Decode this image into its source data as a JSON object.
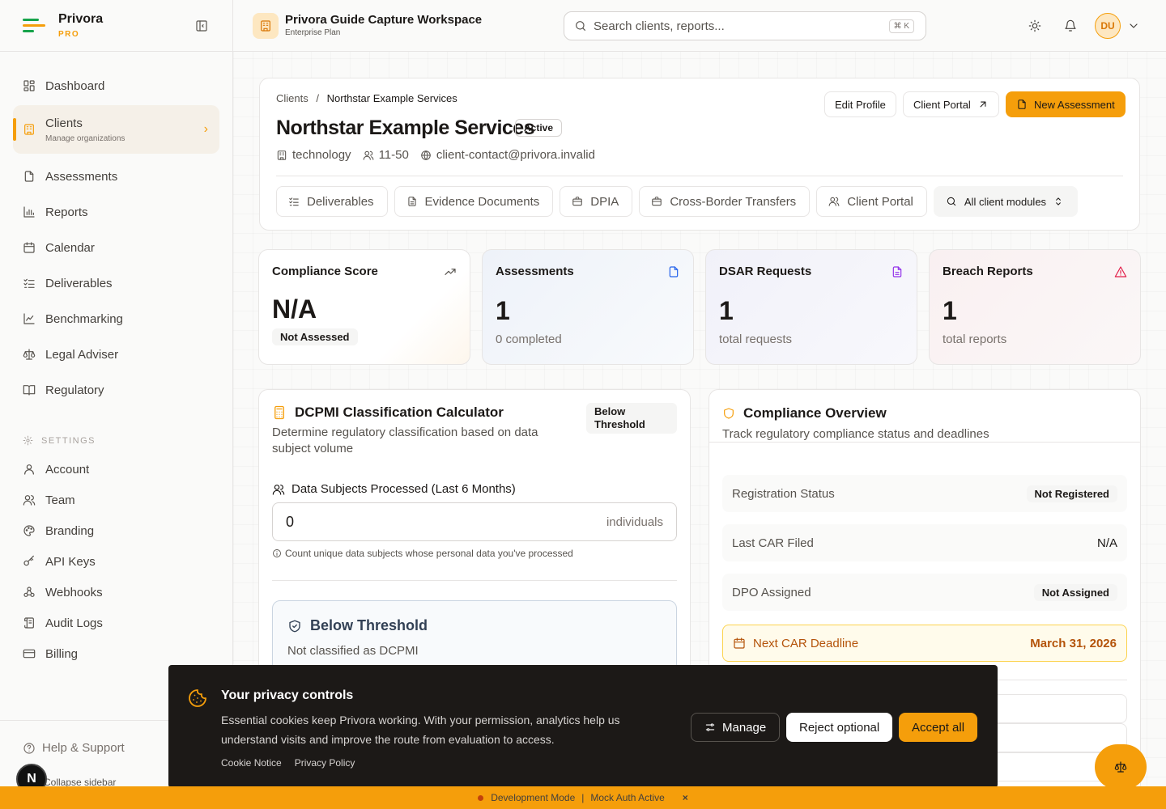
{
  "brand": {
    "name": "Privora",
    "tier": "PRO"
  },
  "sidebar": {
    "items": [
      {
        "label": "Dashboard",
        "icon": "dashboard-icon"
      },
      {
        "label": "Clients",
        "sub": "Manage organizations",
        "icon": "building-icon",
        "active": true
      },
      {
        "label": "Assessments",
        "icon": "file-icon"
      },
      {
        "label": "Reports",
        "icon": "bar-chart-icon"
      },
      {
        "label": "Calendar",
        "icon": "calendar-icon"
      },
      {
        "label": "Deliverables",
        "icon": "list-check-icon"
      },
      {
        "label": "Benchmarking",
        "icon": "line-chart-icon"
      },
      {
        "label": "Legal Adviser",
        "icon": "scale-icon"
      },
      {
        "label": "Regulatory",
        "icon": "book-icon"
      }
    ],
    "settings_heading": "SETTINGS",
    "settings": [
      {
        "label": "Account"
      },
      {
        "label": "Team"
      },
      {
        "label": "Branding"
      },
      {
        "label": "API Keys"
      },
      {
        "label": "Webhooks"
      },
      {
        "label": "Audit Logs"
      },
      {
        "label": "Billing"
      }
    ],
    "help": "Help & Support",
    "collapse": "Collapse sidebar",
    "user_initial": "N"
  },
  "header": {
    "workspace": "Privora Guide Capture Workspace",
    "plan": "Enterprise Plan",
    "search_placeholder": "Search clients, reports...",
    "shortcut": "⌘ K",
    "avatar": "DU"
  },
  "client": {
    "breadcrumb_root": "Clients",
    "breadcrumb_sep": "/",
    "breadcrumb_current": "Northstar Example Services",
    "name": "Northstar Example Services",
    "status": "Active",
    "industry": "technology",
    "size": "11-50",
    "email": "client-contact@privora.invalid",
    "actions": {
      "edit": "Edit Profile",
      "portal": "Client Portal",
      "new": "New Assessment"
    },
    "tabs": [
      "Deliverables",
      "Evidence Documents",
      "DPIA",
      "Cross-Border Transfers",
      "Client Portal"
    ],
    "module_select": "All client modules"
  },
  "stats": [
    {
      "title": "Compliance Score",
      "value": "N/A",
      "sub": "Not Assessed"
    },
    {
      "title": "Assessments",
      "value": "1",
      "sub": "0 completed"
    },
    {
      "title": "DSAR Requests",
      "value": "1",
      "sub": "total requests"
    },
    {
      "title": "Breach Reports",
      "value": "1",
      "sub": "total reports"
    }
  ],
  "calculator": {
    "title": "DCPMI Classification Calculator",
    "subtitle": "Determine regulatory classification based on data subject volume",
    "badge": "Below Threshold",
    "field_label": "Data Subjects Processed (Last 6 Months)",
    "value": "0",
    "unit": "individuals",
    "hint": "Count unique data subjects whose personal data you've processed",
    "result_title": "Below Threshold",
    "result_sub": "Not classified as DCPMI"
  },
  "overview": {
    "title": "Compliance Overview",
    "subtitle": "Track regulatory compliance status and deadlines",
    "rows": [
      {
        "label": "Registration Status",
        "value": "Not Registered",
        "badge": true
      },
      {
        "label": "Last CAR Filed",
        "value": "N/A",
        "badge": false
      },
      {
        "label": "DPO Assigned",
        "value": "Not Assigned",
        "badge": true
      }
    ],
    "deadline_label": "Next CAR Deadline",
    "deadline_date": "March 31, 2026"
  },
  "cookie": {
    "title": "Your privacy controls",
    "text": "Essential cookies keep Privora working. With your permission, analytics help us understand visits and improve the route from evaluation to access.",
    "links": [
      "Cookie Notice",
      "Privacy Policy"
    ],
    "manage": "Manage",
    "reject": "Reject optional",
    "accept": "Accept all"
  },
  "devbar": {
    "mode": "Development Mode",
    "sep": "|",
    "auth": "Mock Auth Active",
    "close": "×"
  },
  "colors": {
    "accent": "#f59e0b",
    "dark": "#1c1917"
  }
}
